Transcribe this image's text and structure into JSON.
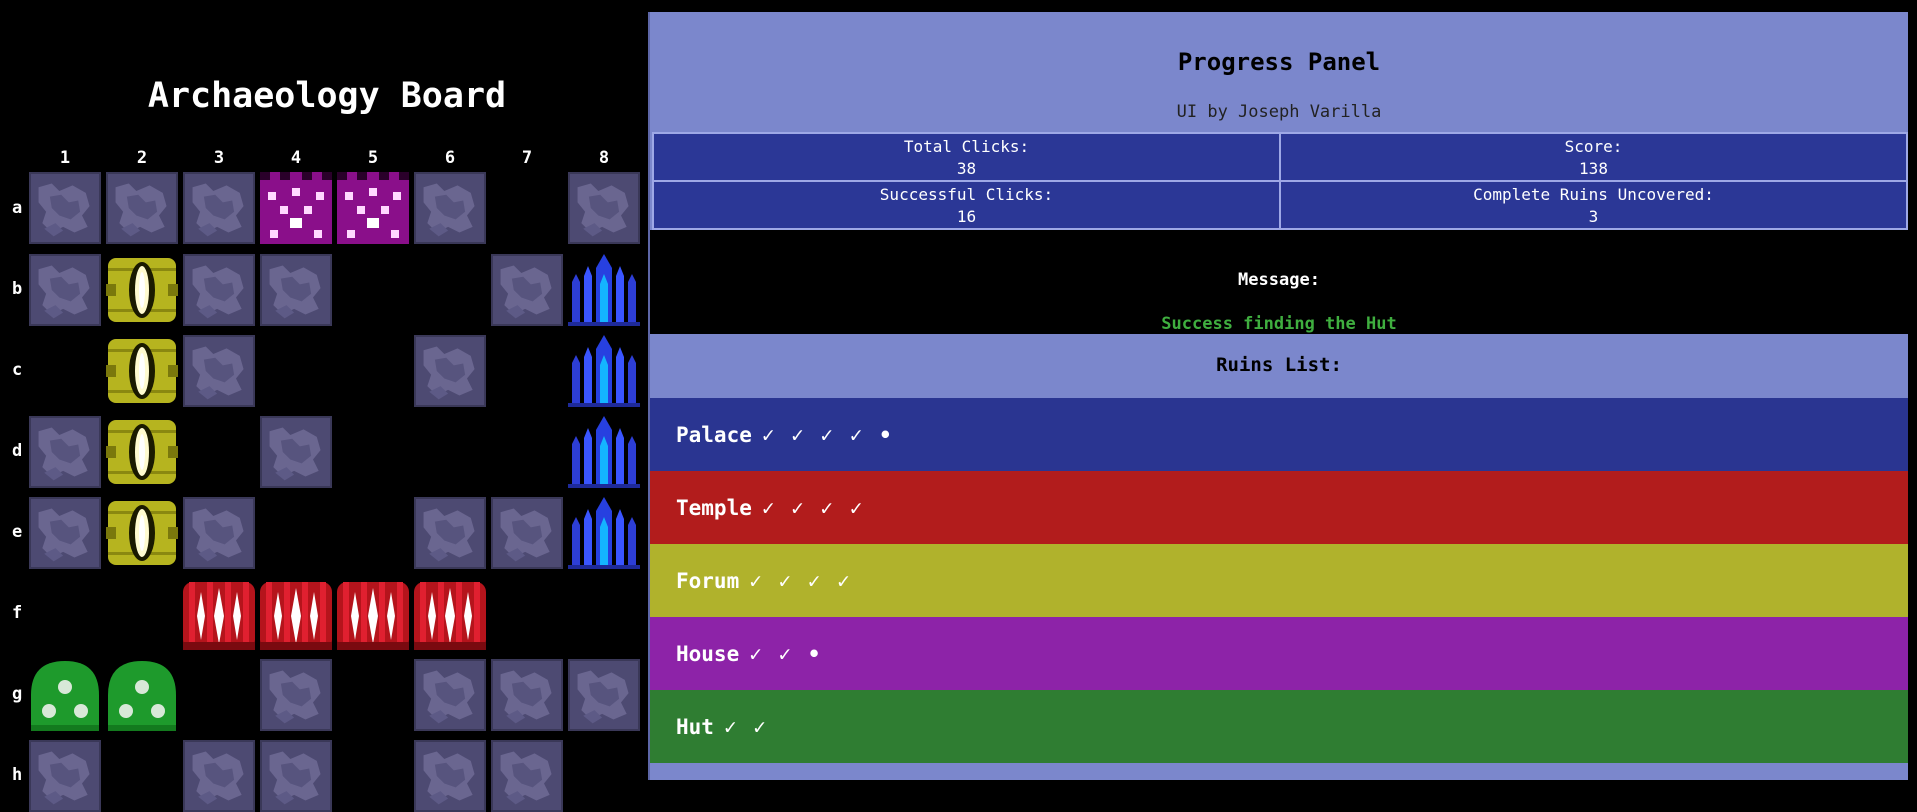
{
  "board": {
    "title": "Archaeology Board",
    "columns": [
      "1",
      "2",
      "3",
      "4",
      "5",
      "6",
      "7",
      "8"
    ],
    "rows": [
      "a",
      "b",
      "c",
      "d",
      "e",
      "f",
      "g",
      "h"
    ],
    "cells": [
      [
        "covered",
        "covered",
        "covered",
        "house",
        "house",
        "covered",
        "empty",
        "covered"
      ],
      [
        "covered",
        "forum",
        "covered",
        "covered",
        "empty",
        "empty",
        "covered",
        "palace"
      ],
      [
        "empty",
        "forum",
        "covered",
        "empty",
        "empty",
        "covered",
        "empty",
        "palace"
      ],
      [
        "covered",
        "forum",
        "empty",
        "covered",
        "empty",
        "empty",
        "empty",
        "palace"
      ],
      [
        "covered",
        "forum",
        "covered",
        "empty",
        "empty",
        "covered",
        "covered",
        "palace"
      ],
      [
        "empty",
        "empty",
        "temple",
        "temple",
        "temple",
        "temple",
        "empty",
        "empty"
      ],
      [
        "hut",
        "hut",
        "empty",
        "covered",
        "empty",
        "covered",
        "covered",
        "covered"
      ],
      [
        "covered",
        "empty",
        "covered",
        "covered",
        "empty",
        "covered",
        "covered",
        "empty"
      ]
    ]
  },
  "panel": {
    "title": "Progress Panel",
    "credit": "UI by Joseph Varilla",
    "stats": {
      "total_clicks_label": "Total Clicks:",
      "total_clicks": "38",
      "score_label": "Score:",
      "score": "138",
      "successful_clicks_label": "Successful Clicks:",
      "successful_clicks": "16",
      "complete_ruins_label": "Complete Ruins Uncovered:",
      "complete_ruins": "3"
    },
    "message_label": "Message:",
    "message": "Success finding the Hut",
    "ruins_label": "Ruins List:",
    "ruins": [
      {
        "name": "Palace",
        "marks": "✓ ✓ ✓ ✓ •",
        "color": "#2a3591"
      },
      {
        "name": "Temple",
        "marks": "✓ ✓ ✓ ✓",
        "color": "#b21c1c"
      },
      {
        "name": "Forum",
        "marks": "✓ ✓ ✓ ✓",
        "color": "#b0b22c"
      },
      {
        "name": "House",
        "marks": "✓ ✓ •",
        "color": "#8d23a8"
      },
      {
        "name": "Hut",
        "marks": "✓ ✓",
        "color": "#2f7d32"
      }
    ]
  }
}
